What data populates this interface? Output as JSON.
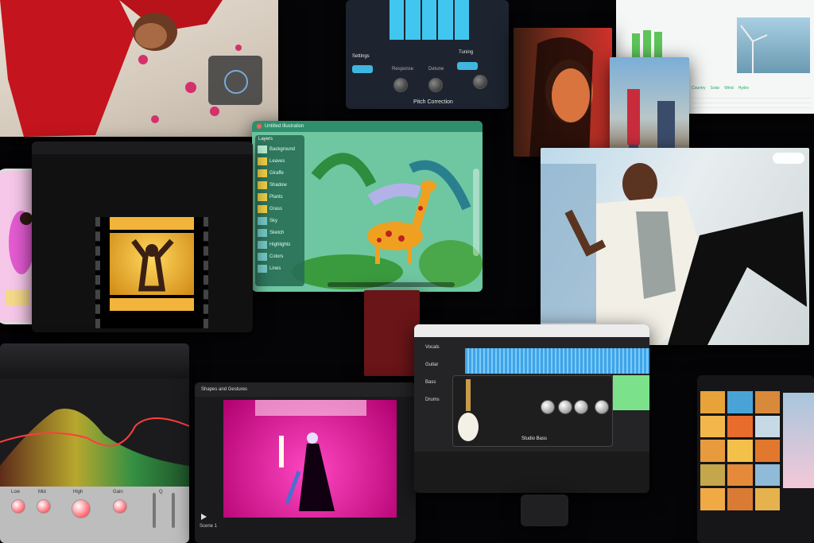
{
  "pitch_correction": {
    "title": "Pitch Correction",
    "section_settings": "Settings",
    "section_tuning": "Tuning",
    "knob_labels": [
      "Response",
      "Detune",
      "Scale"
    ]
  },
  "illustration_app": {
    "doc_title": "Untitled Illustration",
    "layers_title": "Layers",
    "layer_names": [
      "Background",
      "Leaves",
      "Giraffe",
      "Shadow",
      "Plants",
      "Grass",
      "Sky",
      "Sketch",
      "Highlights",
      "Colors",
      "Lines"
    ]
  },
  "spreadsheet": {
    "headers": [
      "Country",
      "Solar",
      "Wind",
      "Hydro"
    ]
  },
  "logic_pro": {
    "plugin_name": "Studio Bass",
    "tracks": [
      "Vocals",
      "Guitar",
      "Bass",
      "Drums"
    ]
  },
  "motion": {
    "window_title": "Shapes and Gestures",
    "subtitle": "Scene 1"
  },
  "eq_plugin": {
    "band_labels": [
      "Low",
      "Mid",
      "High",
      "Gain",
      "Q"
    ]
  },
  "colors": {
    "accent_blue": "#3fb6e0",
    "magenta": "#ff1fa0",
    "green_ui": "#2e8b6a"
  }
}
